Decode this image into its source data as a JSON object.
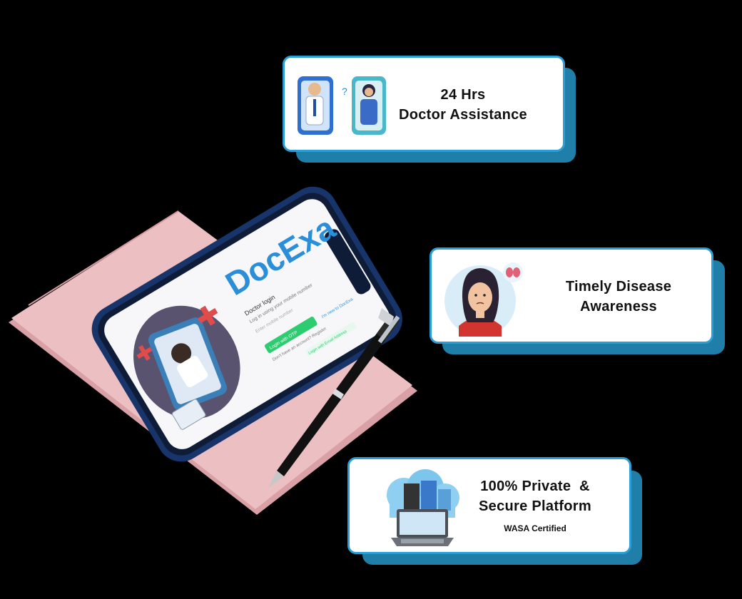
{
  "phone": {
    "brand": "DocExa",
    "screen_title": "Doctor login",
    "screen_subtitle": "Log in using your mobile number",
    "input_placeholder": "Enter mobile number",
    "login_button": "Login with OTP",
    "signup_link": "Don't have an account? Register",
    "side_link": "I'm new to DocExa",
    "hero_caption": "Login with Email Address"
  },
  "cards": [
    {
      "title_line1": "24 Hrs",
      "title_line2": "Doctor Assistance",
      "icon": "doctor-patient-phones-icon"
    },
    {
      "title_line1": "Timely Disease",
      "title_line2": "Awareness",
      "icon": "woman-thyroid-icon"
    },
    {
      "title_line1": "100% Private  &",
      "title_line2": "Secure Platform",
      "subtitle": "WASA Certified",
      "icon": "cloud-laptop-security-icon"
    }
  ],
  "colors": {
    "card_border": "#2a9fd6",
    "card_shadow": "#1f7fa8",
    "notebook": "#e9b9bd",
    "phone_frame": "#1b3f7a",
    "accent_green": "#2ecc71",
    "brand_blue": "#2a8fd8"
  }
}
